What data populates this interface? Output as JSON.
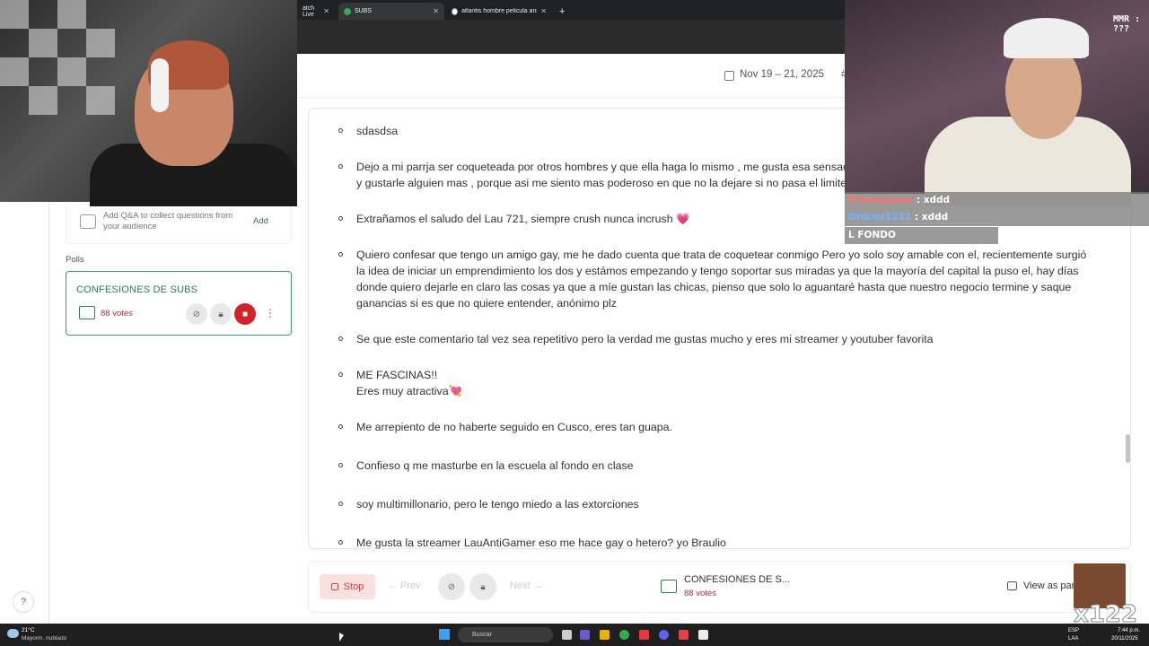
{
  "browser": {
    "tabs": [
      {
        "label": "atch Live",
        "active": false
      },
      {
        "label": "SUBS",
        "active": true
      },
      {
        "label": "atlantis hombre pelicula animad",
        "active": false
      }
    ],
    "new_tab": "+",
    "close": "✕"
  },
  "header": {
    "date_range": "Nov 19 – 21, 2025",
    "hash": "#"
  },
  "sidebar": {
    "qa_text": "Add Q&A to collect questions from your audience",
    "qa_add": "Add",
    "polls_label": "Polls",
    "poll": {
      "title": "CONFESIONES DE SUBS",
      "votes": "88 votes"
    },
    "more": "⋮",
    "help": "?"
  },
  "responses": [
    "sdasdsa",
    "Dejo a mi parrja ser coqueteada por otros hombres y que ella haga lo mismo , me gusta esa sensac",
    "y gustarle alguien mas , porque asi me siento mas poderoso en que no la dejare si no pasa el limite",
    "Extrañamos el saludo del Lau 721, siempre crush nunca incrush 💗",
    "Quiero confesar que tengo un amigo gay, me he dado cuenta que trata de coquetear conmigo Pero yo solo soy amable con el, recientemente surgió",
    "la idea de iniciar un emprendimiento los dos y estámos empezando y tengo soportar sus miradas ya que la mayoría del capital la puso el, hay días",
    "donde quiero dejarle en claro las cosas ya que a míe gustan las chicas, pienso que solo lo aguantaré hasta que nuestro negocio termine y saque",
    "ganancias si es que no quiere entender, anónimo plz",
    "Se que este comentario tal vez sea repetitivo pero la verdad me gustas mucho y eres mi streamer y youtuber favorita",
    "ME FASCINAS!!",
    "Eres muy atractiva💘",
    "Me arrepiento de no haberte seguido en Cusco, eres tan guapa.",
    "Confieso q me masturbe en la escuela al fondo en clase",
    "soy multimillonario, pero le tengo miedo a las extorciones",
    "Me gusta la streamer LauAntiGamer eso me hace gay o hetero? yo Braulio"
  ],
  "bottom_bar": {
    "stop": "Stop",
    "prev": "← Prev",
    "next": "Next →",
    "poll_title": "CONFESIONES DE S...",
    "poll_votes": "88 votes",
    "view_as": "View as par"
  },
  "overlay": {
    "mmr": "MMR : ???",
    "chat": [
      {
        "user": "Fredelyaaaa",
        "msg": ": xddd"
      },
      {
        "user": "Ordree1231",
        "msg": ": xddd"
      },
      {
        "user": "",
        "msg": "L FONDO"
      }
    ],
    "multiplier": "x122"
  },
  "taskbar": {
    "weather_temp": "21°C",
    "weather_desc": "Mayorm. nublado",
    "search": "Buscar",
    "lang1": "ESP",
    "lang2": "LAA",
    "time": "7:44 p.m.",
    "date": "20/11/2025"
  },
  "colors": {
    "accent": "#2e7d4f",
    "stop": "#d2232a",
    "votes": "#b03040"
  }
}
